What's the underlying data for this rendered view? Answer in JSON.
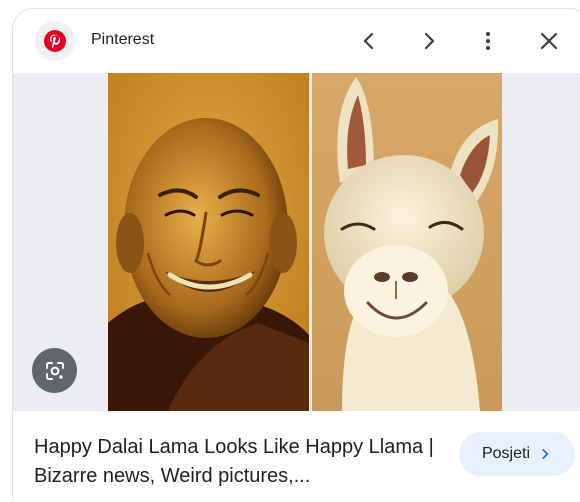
{
  "source": {
    "name": "Pinterest",
    "favicon_icon": "pinterest-logo-icon",
    "brand_color": "#e60023"
  },
  "header_actions": {
    "previous_icon": "chevron-left-icon",
    "next_icon": "chevron-right-icon",
    "more_icon": "more-vertical-icon",
    "close_icon": "close-icon"
  },
  "result": {
    "title": "Happy Dalai Lama Looks Like Happy Llama | Bizarre news, Weird pictures,...",
    "visit_label": "Posjeti",
    "visit_icon": "chevron-right-icon",
    "visit_color": "#1a73e8"
  },
  "lens": {
    "icon": "google-lens-icon"
  }
}
